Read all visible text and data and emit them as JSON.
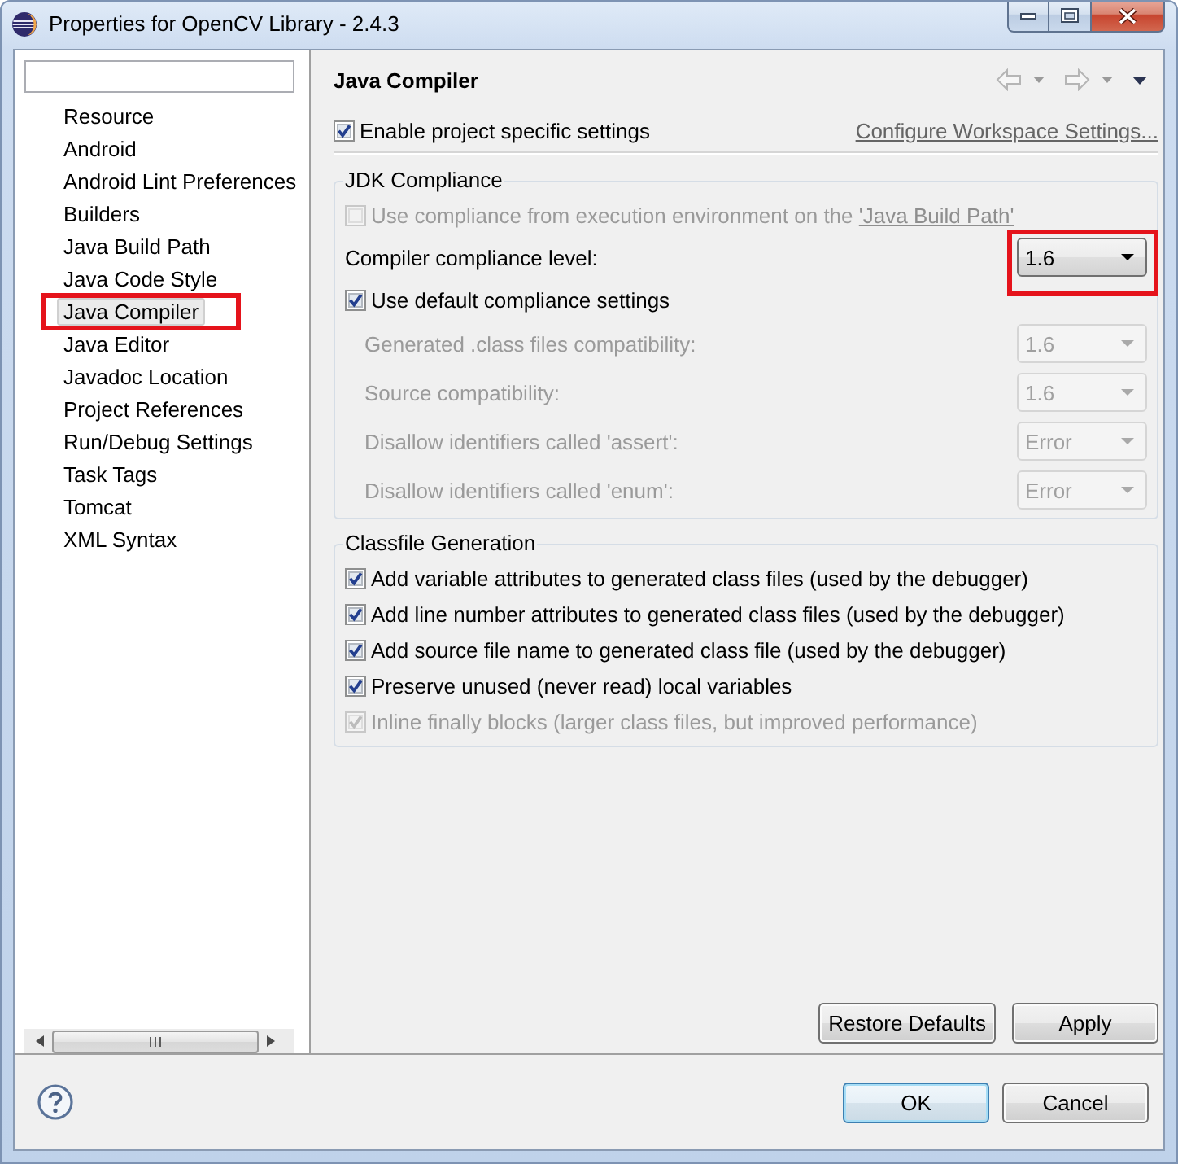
{
  "window": {
    "title": "Properties for OpenCV Library - 2.4.3"
  },
  "sidebar": {
    "items": [
      {
        "label": "Resource",
        "selected": false,
        "annotated": false
      },
      {
        "label": "Android",
        "selected": false,
        "annotated": false
      },
      {
        "label": "Android Lint Preferences",
        "selected": false,
        "annotated": false
      },
      {
        "label": "Builders",
        "selected": false,
        "annotated": false
      },
      {
        "label": "Java Build Path",
        "selected": false,
        "annotated": false
      },
      {
        "label": "Java Code Style",
        "selected": false,
        "annotated": false
      },
      {
        "label": "Java Compiler",
        "selected": true,
        "annotated": true
      },
      {
        "label": "Java Editor",
        "selected": false,
        "annotated": false
      },
      {
        "label": "Javadoc Location",
        "selected": false,
        "annotated": false
      },
      {
        "label": "Project References",
        "selected": false,
        "annotated": false
      },
      {
        "label": "Run/Debug Settings",
        "selected": false,
        "annotated": false
      },
      {
        "label": "Task Tags",
        "selected": false,
        "annotated": false
      },
      {
        "label": "Tomcat",
        "selected": false,
        "annotated": false
      },
      {
        "label": "XML Syntax",
        "selected": false,
        "annotated": false
      }
    ]
  },
  "page": {
    "title": "Java Compiler",
    "project_specific": {
      "label": "Enable project specific settings",
      "checked": true
    },
    "workspace_link": "Configure Workspace Settings...",
    "groups": [
      {
        "title": "JDK Compliance",
        "rows": [
          {
            "kind": "checkbox",
            "label": "Use compliance from execution environment on the ",
            "link": "'Java Build Path'",
            "checked": false,
            "disabled": true
          },
          {
            "kind": "combo",
            "label": "Compiler compliance level:",
            "value": "1.6",
            "disabled": false,
            "annotated": true
          },
          {
            "kind": "checkbox",
            "label": "Use default compliance settings",
            "checked": true,
            "disabled": false,
            "children": [
              {
                "kind": "combo",
                "label": "Generated .class files compatibility:",
                "value": "1.6",
                "disabled": true,
                "annotated": false
              },
              {
                "kind": "combo",
                "label": "Source compatibility:",
                "value": "1.6",
                "disabled": true,
                "annotated": false
              },
              {
                "kind": "combo",
                "label": "Disallow identifiers called 'assert':",
                "value": "Error",
                "disabled": true,
                "annotated": false
              },
              {
                "kind": "combo",
                "label": "Disallow identifiers called 'enum':",
                "value": "Error",
                "disabled": true,
                "annotated": false
              }
            ]
          }
        ]
      },
      {
        "title": "Classfile Generation",
        "rows": [
          {
            "kind": "checkbox",
            "label": "Add variable attributes to generated class files (used by the debugger)",
            "checked": true,
            "disabled": false
          },
          {
            "kind": "checkbox",
            "label": "Add line number attributes to generated class files (used by the debugger)",
            "checked": true,
            "disabled": false
          },
          {
            "kind": "checkbox",
            "label": "Add source file name to generated class file (used by the debugger)",
            "checked": true,
            "disabled": false
          },
          {
            "kind": "checkbox",
            "label": "Preserve unused (never read) local variables",
            "checked": true,
            "disabled": false
          },
          {
            "kind": "checkbox",
            "label": "Inline finally blocks (larger class files, but improved performance)",
            "checked": true,
            "disabled": true
          }
        ]
      }
    ],
    "buttons": [
      "Restore Defaults",
      "Apply"
    ]
  },
  "dialog_buttons": [
    {
      "label": "OK",
      "default": true
    },
    {
      "label": "Cancel",
      "default": false
    }
  ]
}
